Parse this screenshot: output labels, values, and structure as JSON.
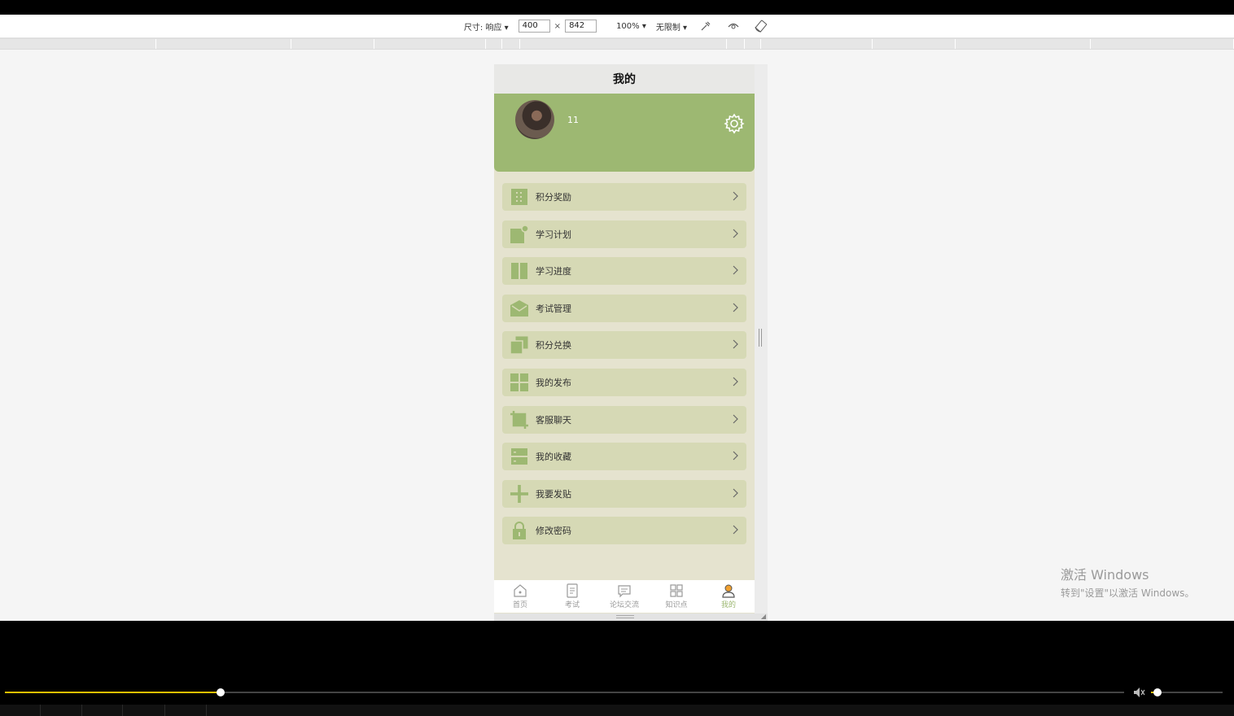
{
  "devtools": {
    "size_label": "尺寸: 响应 ▾",
    "width_value": "400",
    "times": "×",
    "height_value": "842",
    "zoom_label": "100% ▾",
    "throttle_label": "无限制 ▾"
  },
  "page": {
    "title": "我的"
  },
  "profile": {
    "username": "11"
  },
  "menu": [
    {
      "label": "积分奖励",
      "icon": "grid-dots-icon"
    },
    {
      "label": "学习计划",
      "icon": "notification-square-icon"
    },
    {
      "label": "学习进度",
      "icon": "columns-icon"
    },
    {
      "label": "考试管理",
      "icon": "envelope-icon"
    },
    {
      "label": "积分兑换",
      "icon": "copy-icon"
    },
    {
      "label": "我的发布",
      "icon": "grid-icon"
    },
    {
      "label": "客服聊天",
      "icon": "crop-icon"
    },
    {
      "label": "我的收藏",
      "icon": "drawer-icon"
    },
    {
      "label": "我要发贴",
      "icon": "plus-icon"
    },
    {
      "label": "修改密码",
      "icon": "lock-icon"
    }
  ],
  "tabbar": [
    {
      "label": "首页",
      "icon": "home-icon"
    },
    {
      "label": "考试",
      "icon": "document-icon"
    },
    {
      "label": "论坛交流",
      "icon": "message-icon"
    },
    {
      "label": "知识点",
      "icon": "apps-icon"
    },
    {
      "label": "我的",
      "icon": "user-icon",
      "active": true
    }
  ],
  "watermark": {
    "line1": "激活 Windows",
    "line2": "转到\"设置\"以激活 Windows。"
  },
  "player": {
    "progress": 0.193,
    "volume": 0.09
  },
  "colors": {
    "accent": "#9db872",
    "menu_bg": "#d6d9b5",
    "page_bg": "#e5e3cf"
  }
}
